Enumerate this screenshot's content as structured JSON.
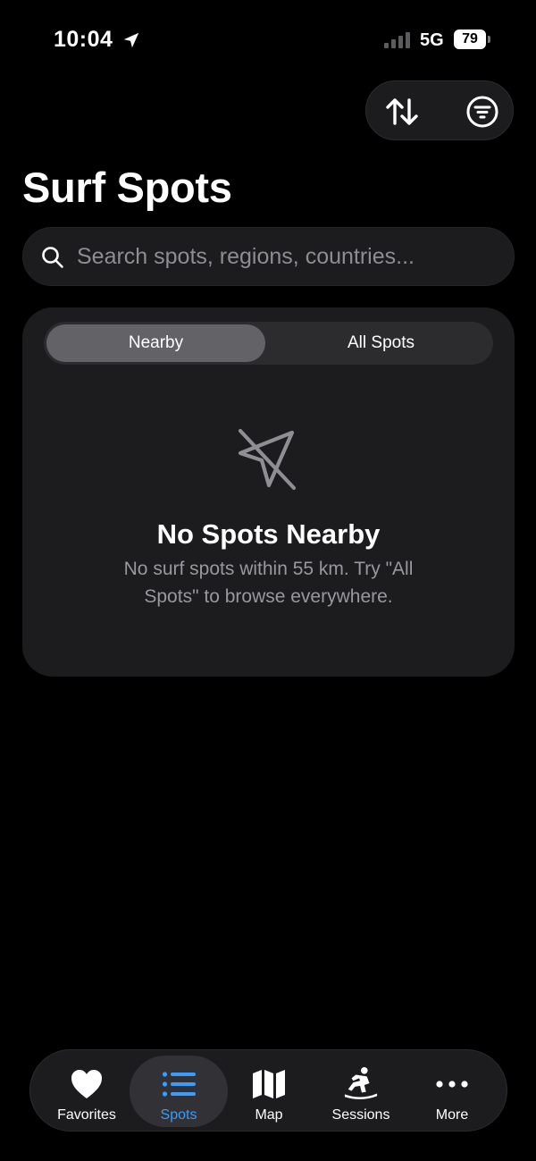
{
  "status_bar": {
    "time": "10:04",
    "network": "5G",
    "battery": "79"
  },
  "header": {
    "title": "Surf Spots",
    "sort_icon": "arrow-up-down-icon",
    "filter_icon": "filter-lines-icon"
  },
  "search": {
    "placeholder": "Search spots, regions, countries..."
  },
  "segmented_control": {
    "options": [
      "Nearby",
      "All Spots"
    ],
    "selected": "Nearby"
  },
  "empty_state": {
    "icon": "location-slash-icon",
    "title": "No Spots Nearby",
    "message": "No surf spots within 55 km. Try \"All Spots\" to browse everywhere."
  },
  "tab_bar": {
    "selected": "Spots",
    "accent_color": "#3a9cff",
    "items": [
      {
        "label": "Favorites",
        "icon": "heart-icon"
      },
      {
        "label": "Spots",
        "icon": "list-icon"
      },
      {
        "label": "Map",
        "icon": "map-icon"
      },
      {
        "label": "Sessions",
        "icon": "surfer-icon"
      },
      {
        "label": "More",
        "icon": "ellipsis-icon"
      }
    ]
  }
}
